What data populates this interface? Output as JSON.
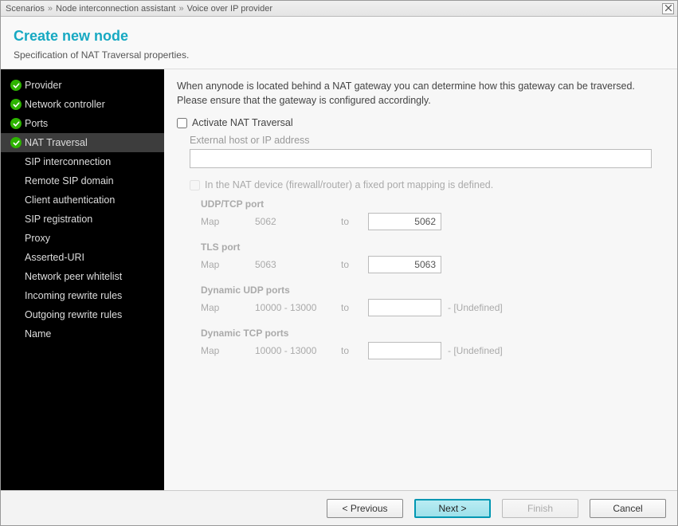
{
  "breadcrumb": {
    "a": "Scenarios",
    "b": "Node interconnection assistant",
    "c": "Voice over IP provider"
  },
  "header": {
    "title": "Create new node",
    "subtitle": "Specification of NAT Traversal properties."
  },
  "sidebar": {
    "items": [
      {
        "label": "Provider",
        "done": true
      },
      {
        "label": "Network controller",
        "done": true
      },
      {
        "label": "Ports",
        "done": true
      },
      {
        "label": "NAT Traversal",
        "done": true,
        "active": true
      },
      {
        "label": "SIP interconnection"
      },
      {
        "label": "Remote SIP domain"
      },
      {
        "label": "Client authentication"
      },
      {
        "label": "SIP registration"
      },
      {
        "label": "Proxy"
      },
      {
        "label": "Asserted-URI"
      },
      {
        "label": "Network peer whitelist"
      },
      {
        "label": "Incoming rewrite rules"
      },
      {
        "label": "Outgoing rewrite rules"
      },
      {
        "label": "Name"
      }
    ]
  },
  "content": {
    "intro": "When anynode is located behind a NAT gateway you can determine how this gateway can be traversed. Please ensure that the gateway is configured accordingly.",
    "activate_label": "Activate NAT Traversal",
    "activate_checked": false,
    "ext_host_label": "External host or IP address",
    "ext_host_value": "",
    "fixed_mapping_label": "In the NAT device (firewall/router) a fixed port mapping is defined.",
    "fixed_mapping_checked": false,
    "map_label": "Map",
    "to_label": "to",
    "undefined_suffix": "- [Undefined]",
    "ports": {
      "udptcp": {
        "title": "UDP/TCP port",
        "src": "5062",
        "dst": "5062"
      },
      "tls": {
        "title": "TLS port",
        "src": "5063",
        "dst": "5063"
      },
      "dudp": {
        "title": "Dynamic UDP ports",
        "src": "10000 - 13000",
        "dst": ""
      },
      "dtcp": {
        "title": "Dynamic TCP ports",
        "src": "10000 - 13000",
        "dst": ""
      }
    }
  },
  "footer": {
    "previous": "< Previous",
    "next": "Next >",
    "finish": "Finish",
    "cancel": "Cancel"
  }
}
